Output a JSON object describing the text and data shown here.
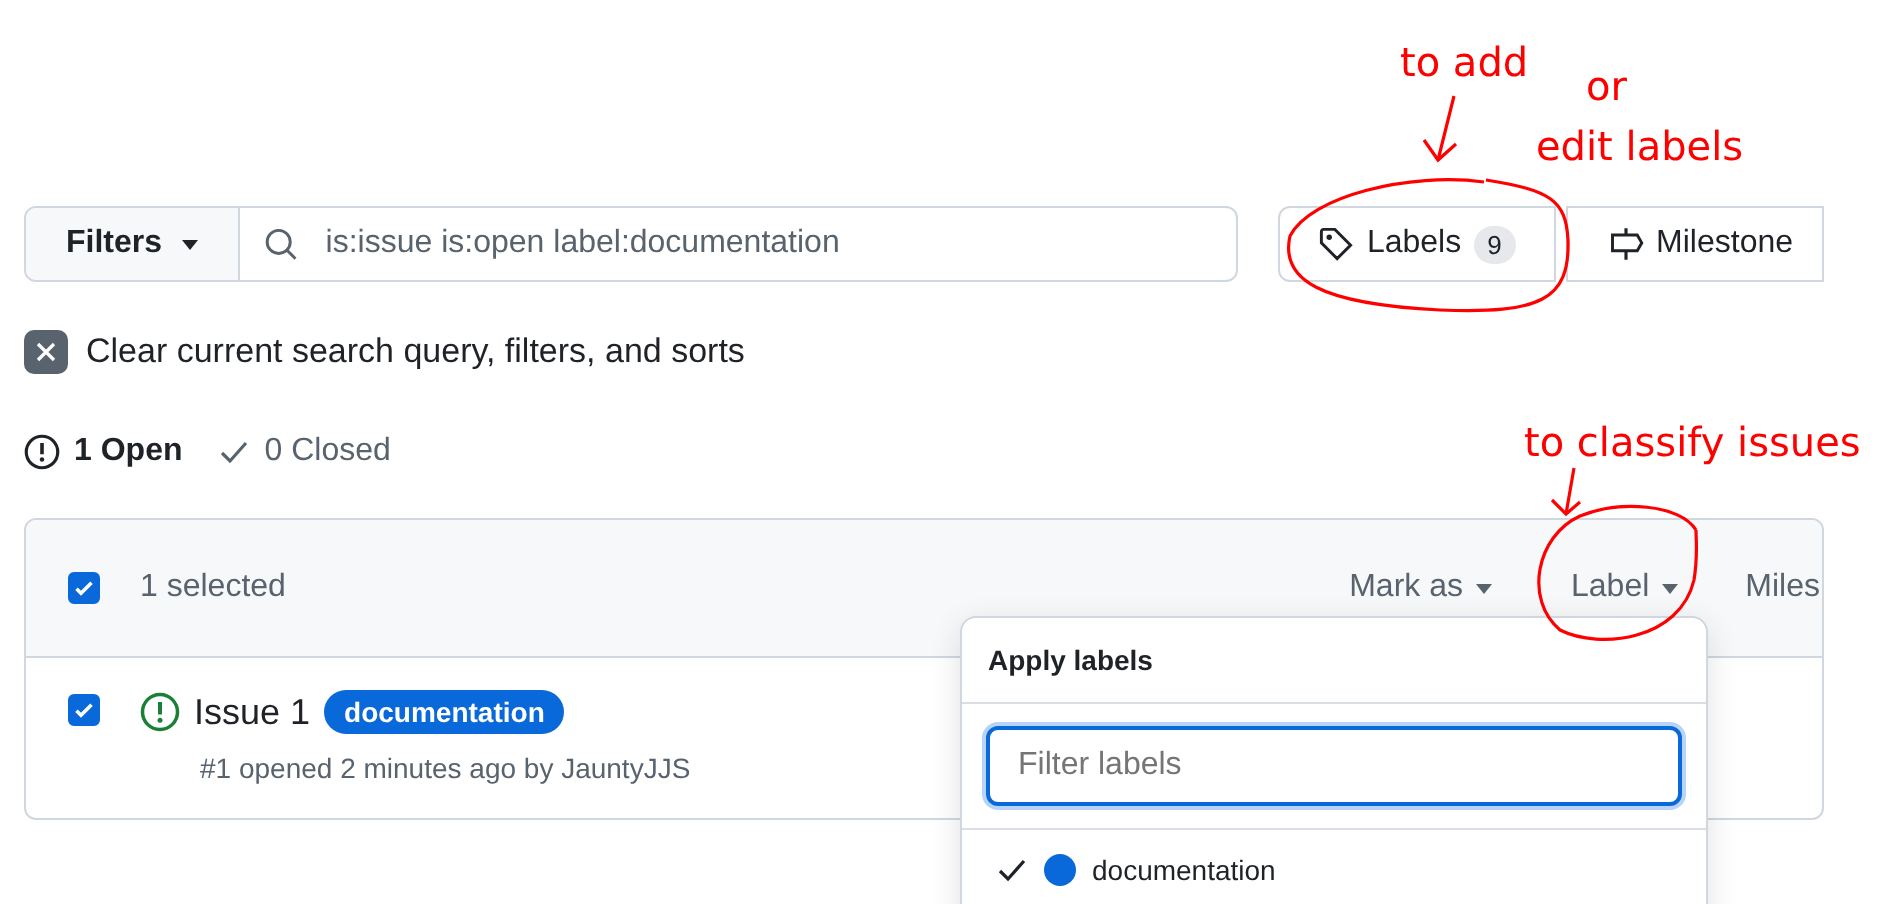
{
  "search": {
    "filters_button": "Filters",
    "query": "is:issue is:open label:documentation"
  },
  "toolbar_buttons": [
    {
      "kind": "labels",
      "label": "Labels",
      "count": "9"
    },
    {
      "kind": "milestones",
      "label": "Milestone"
    }
  ],
  "clear_filters": "Clear current search query, filters, and sorts",
  "states": [
    {
      "label": "1 Open",
      "selected": true
    },
    {
      "label": "0 Closed",
      "selected": false
    }
  ],
  "issue_list": {
    "header": {
      "checked": true,
      "selected_count": "1 selected",
      "actions": [
        "Mark as",
        "Label",
        "Miles"
      ]
    },
    "issues": [
      {
        "checked": true,
        "title": "Issue 1",
        "labels": [
          {
            "name": "documentation",
            "color": "#0969da"
          }
        ],
        "meta": "#1 opened 2 minutes ago by JauntyJJS"
      }
    ]
  },
  "label_menu": {
    "title": "Apply labels",
    "filter": {
      "placeholder": "Filter labels"
    },
    "items": [
      {
        "name": "documentation",
        "color": "#0969da",
        "checked": true
      }
    ]
  },
  "annotations": [
    {
      "lines": [
        "to add",
        "or",
        "edit labels"
      ]
    },
    {
      "lines": [
        "to classify issues"
      ]
    }
  ]
}
